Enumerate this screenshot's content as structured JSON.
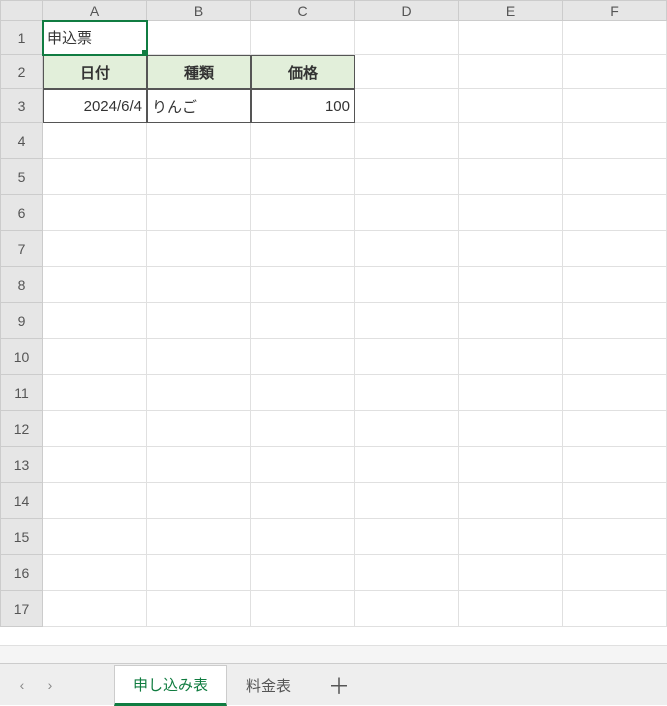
{
  "columns": [
    "A",
    "B",
    "C",
    "D",
    "E",
    "F"
  ],
  "rowCount": 17,
  "activeCell": {
    "row": 1,
    "col": "A"
  },
  "cells": {
    "A1": {
      "value": "申込票",
      "align": "left"
    },
    "A2": {
      "value": "日付",
      "style": "th"
    },
    "B2": {
      "value": "種類",
      "style": "th"
    },
    "C2": {
      "value": "価格",
      "style": "th"
    },
    "A3": {
      "value": "2024/6/4",
      "style": "data",
      "align": "right"
    },
    "B3": {
      "value": "りんご",
      "style": "data",
      "align": "left"
    },
    "C3": {
      "value": "100",
      "style": "data",
      "align": "right"
    }
  },
  "tabs": {
    "items": [
      {
        "label": "申し込み表",
        "active": true
      },
      {
        "label": "料金表",
        "active": false
      }
    ],
    "addIcon": "＋"
  },
  "nav": {
    "prev": "‹",
    "next": "›"
  }
}
